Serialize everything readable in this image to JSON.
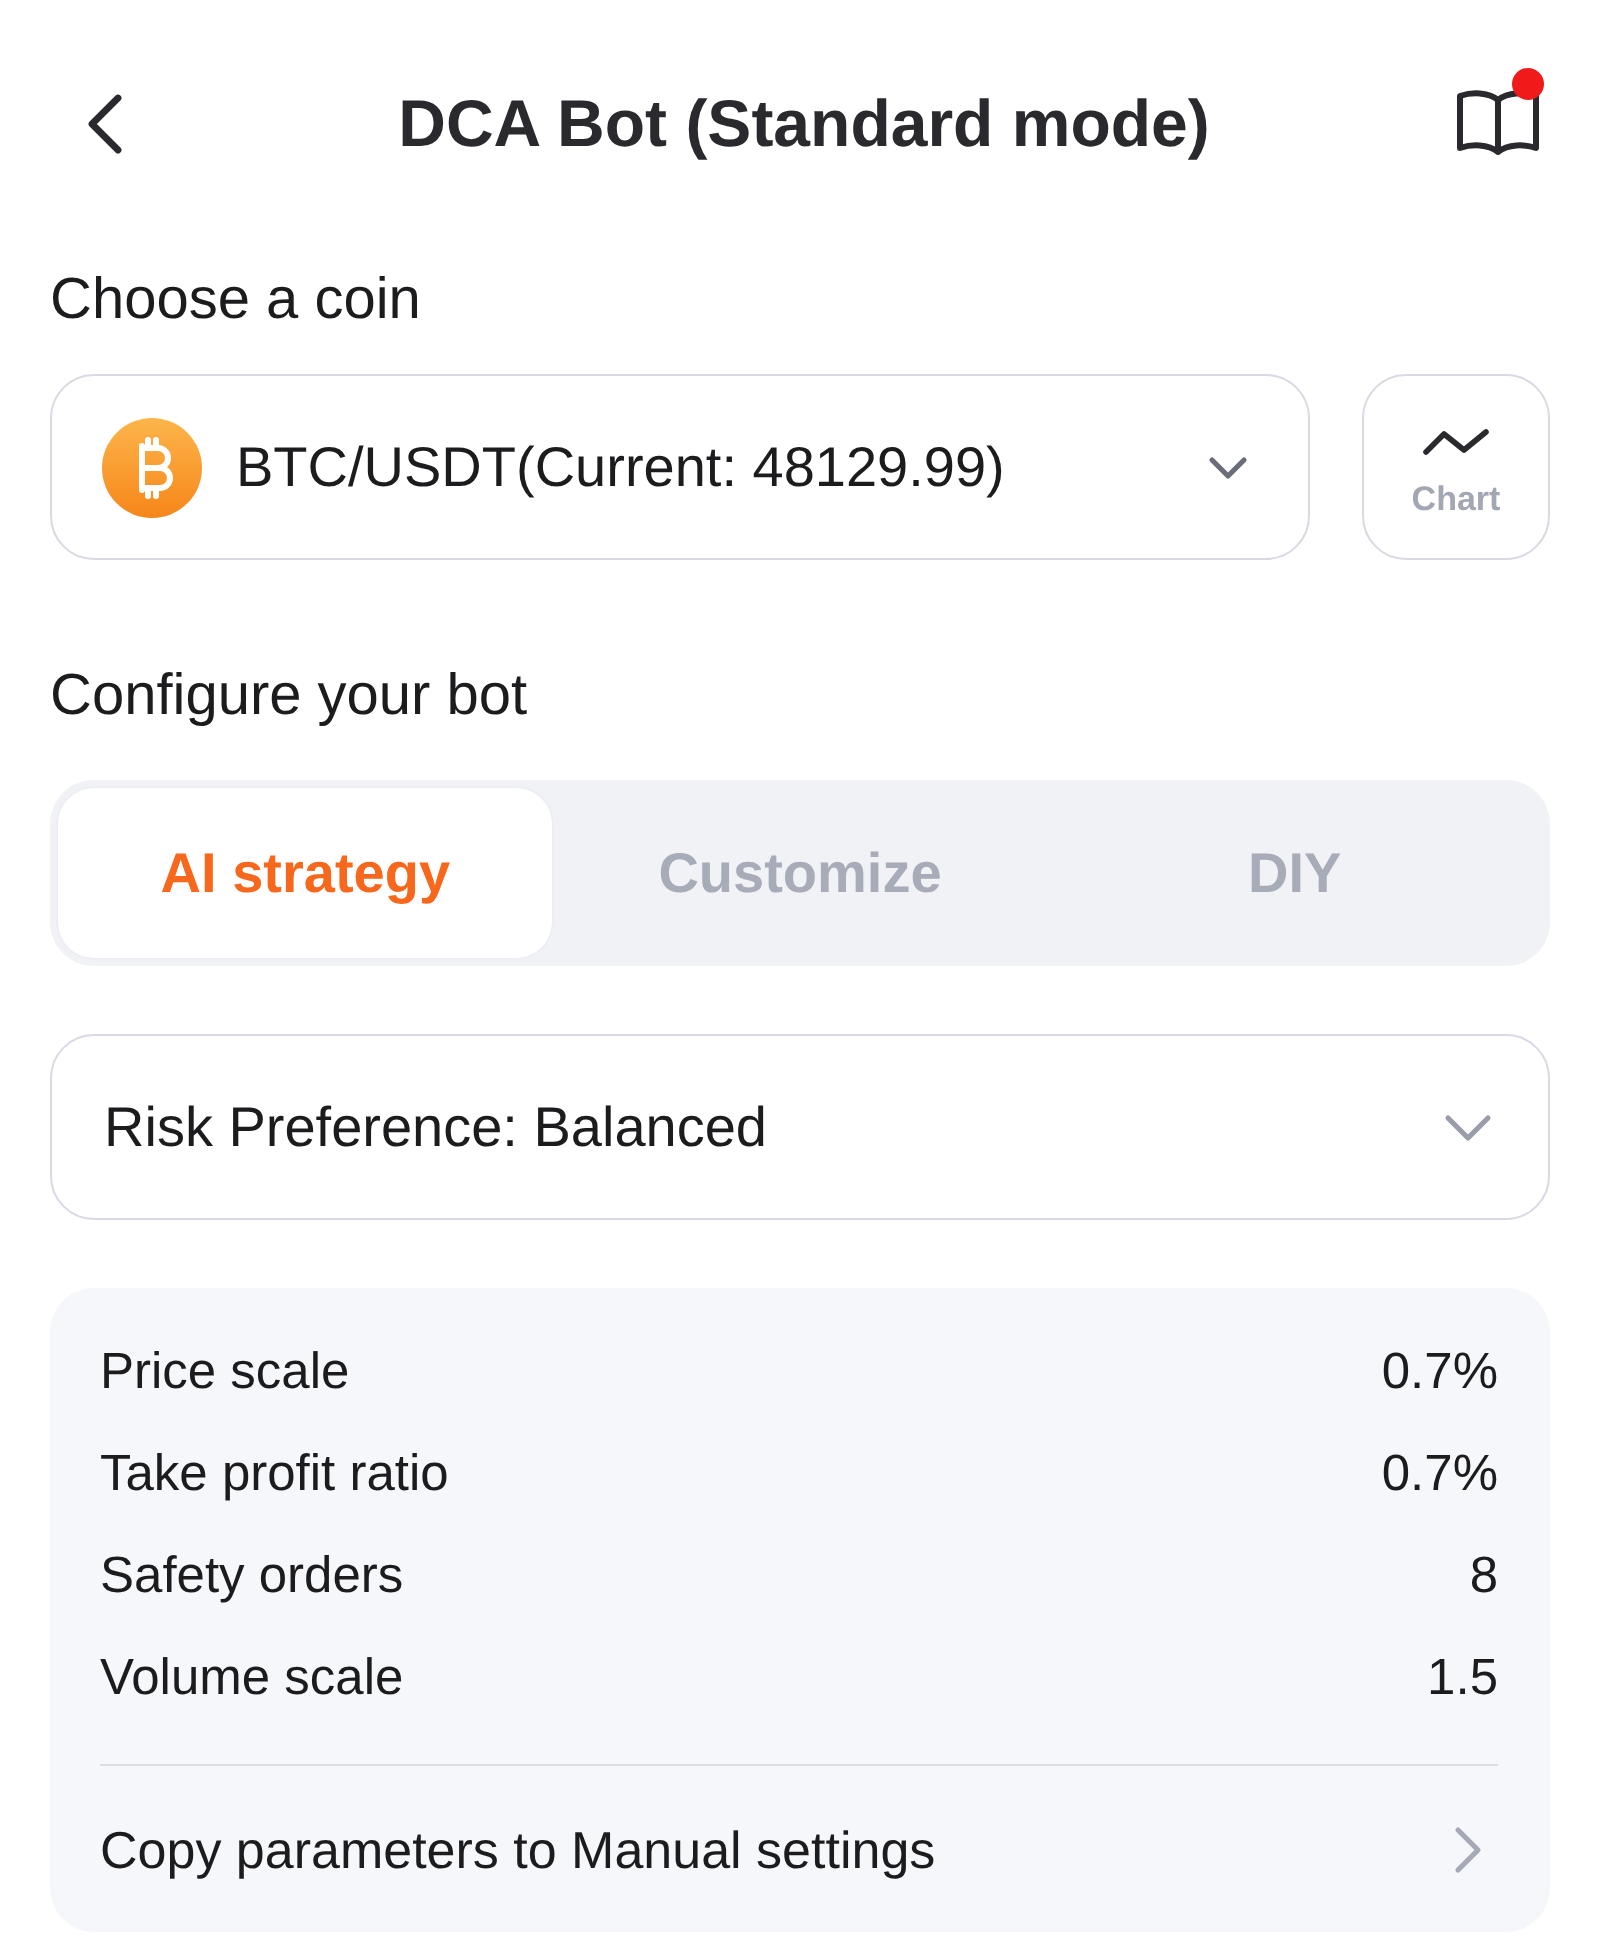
{
  "header": {
    "title": "DCA Bot (Standard mode)",
    "notification_dot": true
  },
  "coin_section": {
    "heading": "Choose a coin",
    "selector": {
      "value": "BTC/USDT(Current: 48129.99)"
    },
    "chart_button": {
      "label": "Chart"
    }
  },
  "config_section": {
    "heading": "Configure your bot",
    "tabs": [
      {
        "label": "AI strategy",
        "selected": true
      },
      {
        "label": "Customize",
        "selected": false
      },
      {
        "label": "DIY",
        "selected": false
      }
    ],
    "risk_dropdown": {
      "value": "Risk Preference: Balanced"
    },
    "parameters": [
      {
        "label": "Price scale",
        "value": "0.7%"
      },
      {
        "label": "Take profit ratio",
        "value": "0.7%"
      },
      {
        "label": "Safety orders",
        "value": "8"
      },
      {
        "label": "Volume scale",
        "value": "1.5"
      }
    ],
    "copy_link": {
      "label": "Copy parameters to Manual settings"
    }
  }
}
